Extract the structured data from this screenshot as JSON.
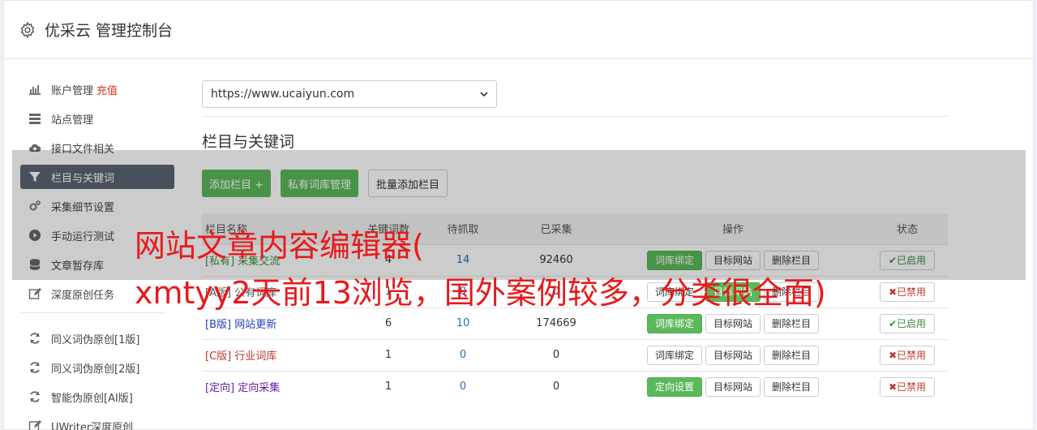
{
  "header": {
    "title": "优采云 管理控制台",
    "icon": "gear-icon"
  },
  "sidebar": {
    "items": [
      {
        "label": "账户管理",
        "extra": "充值",
        "icon": "bar-chart-icon"
      },
      {
        "label": "站点管理",
        "icon": "server-icon"
      },
      {
        "label": "接口文件相关",
        "icon": "cloud-upload-icon"
      },
      {
        "label": "栏目与关键词",
        "icon": "filter-icon",
        "active": true
      },
      {
        "label": "采集细节设置",
        "icon": "cogs-icon"
      },
      {
        "label": "手动运行测试",
        "icon": "play-circle-icon"
      },
      {
        "label": "文章暂存库",
        "icon": "database-icon"
      },
      {
        "label": "深度原创任务",
        "icon": "edit-icon"
      }
    ],
    "items2": [
      {
        "label": "同义词伪原创[1版]",
        "icon": "refresh-icon"
      },
      {
        "label": "同义词伪原创[2版]",
        "icon": "refresh-icon"
      },
      {
        "label": "智能伪原创[AI版]",
        "icon": "refresh-icon"
      },
      {
        "label": "UWriter深度原创",
        "icon": "edit-icon"
      }
    ]
  },
  "main": {
    "site_select": "https://www.ucaiyun.com",
    "section_title": "栏目与关键词",
    "buttons": {
      "add": "添加栏目 +",
      "private": "私有词库管理",
      "batch": "批量添加栏目"
    },
    "table": {
      "headers": [
        "栏目名称",
        "关键词数",
        "待抓取",
        "已采集",
        "操作",
        "状态"
      ],
      "rows": [
        {
          "tag": "[私有]",
          "name": "采集交流",
          "kw": "4",
          "pending": "14",
          "collected": "92460",
          "op1": "词库绑定",
          "op1_green": true,
          "op2": "目标网站",
          "op3": "删除栏目",
          "status": "✔已启用",
          "on": true,
          "color": "c-green"
        },
        {
          "tag": "[A版]",
          "name": "公有词库",
          "kw": "1",
          "pending": "0",
          "collected": "0",
          "op1": "词库绑定",
          "op1_green": false,
          "op2": "目标网站",
          "op2_green": true,
          "op3": "删除栏目",
          "status": "✖已禁用",
          "on": false,
          "color": "c-gray"
        },
        {
          "tag": "[B版]",
          "name": "网站更新",
          "kw": "6",
          "pending": "10",
          "collected": "174669",
          "op1": "词库绑定",
          "op1_green": true,
          "op2": "目标网站",
          "op3": "删除栏目",
          "status": "✔已启用",
          "on": true,
          "color": "c-blue"
        },
        {
          "tag": "[C版]",
          "name": "行业词库",
          "kw": "1",
          "pending": "0",
          "collected": "0",
          "op1": "词库绑定",
          "op1_green": false,
          "op2": "目标网站",
          "op3": "删除栏目",
          "status": "✖已禁用",
          "on": false,
          "color": "c-red"
        },
        {
          "tag": "[定向]",
          "name": "定向采集",
          "kw": "1",
          "pending": "0",
          "collected": "0",
          "op1": "定向设置",
          "op1_green": true,
          "op2": "目标网站",
          "op3": "删除栏目",
          "status": "✖已禁用",
          "on": false,
          "color": "c-purple"
        }
      ]
    }
  },
  "overlay": {
    "line1": "网站文章内容编辑器(",
    "line2": "xmtyy2天前13浏览，国外案例较多，分类很全面)"
  }
}
